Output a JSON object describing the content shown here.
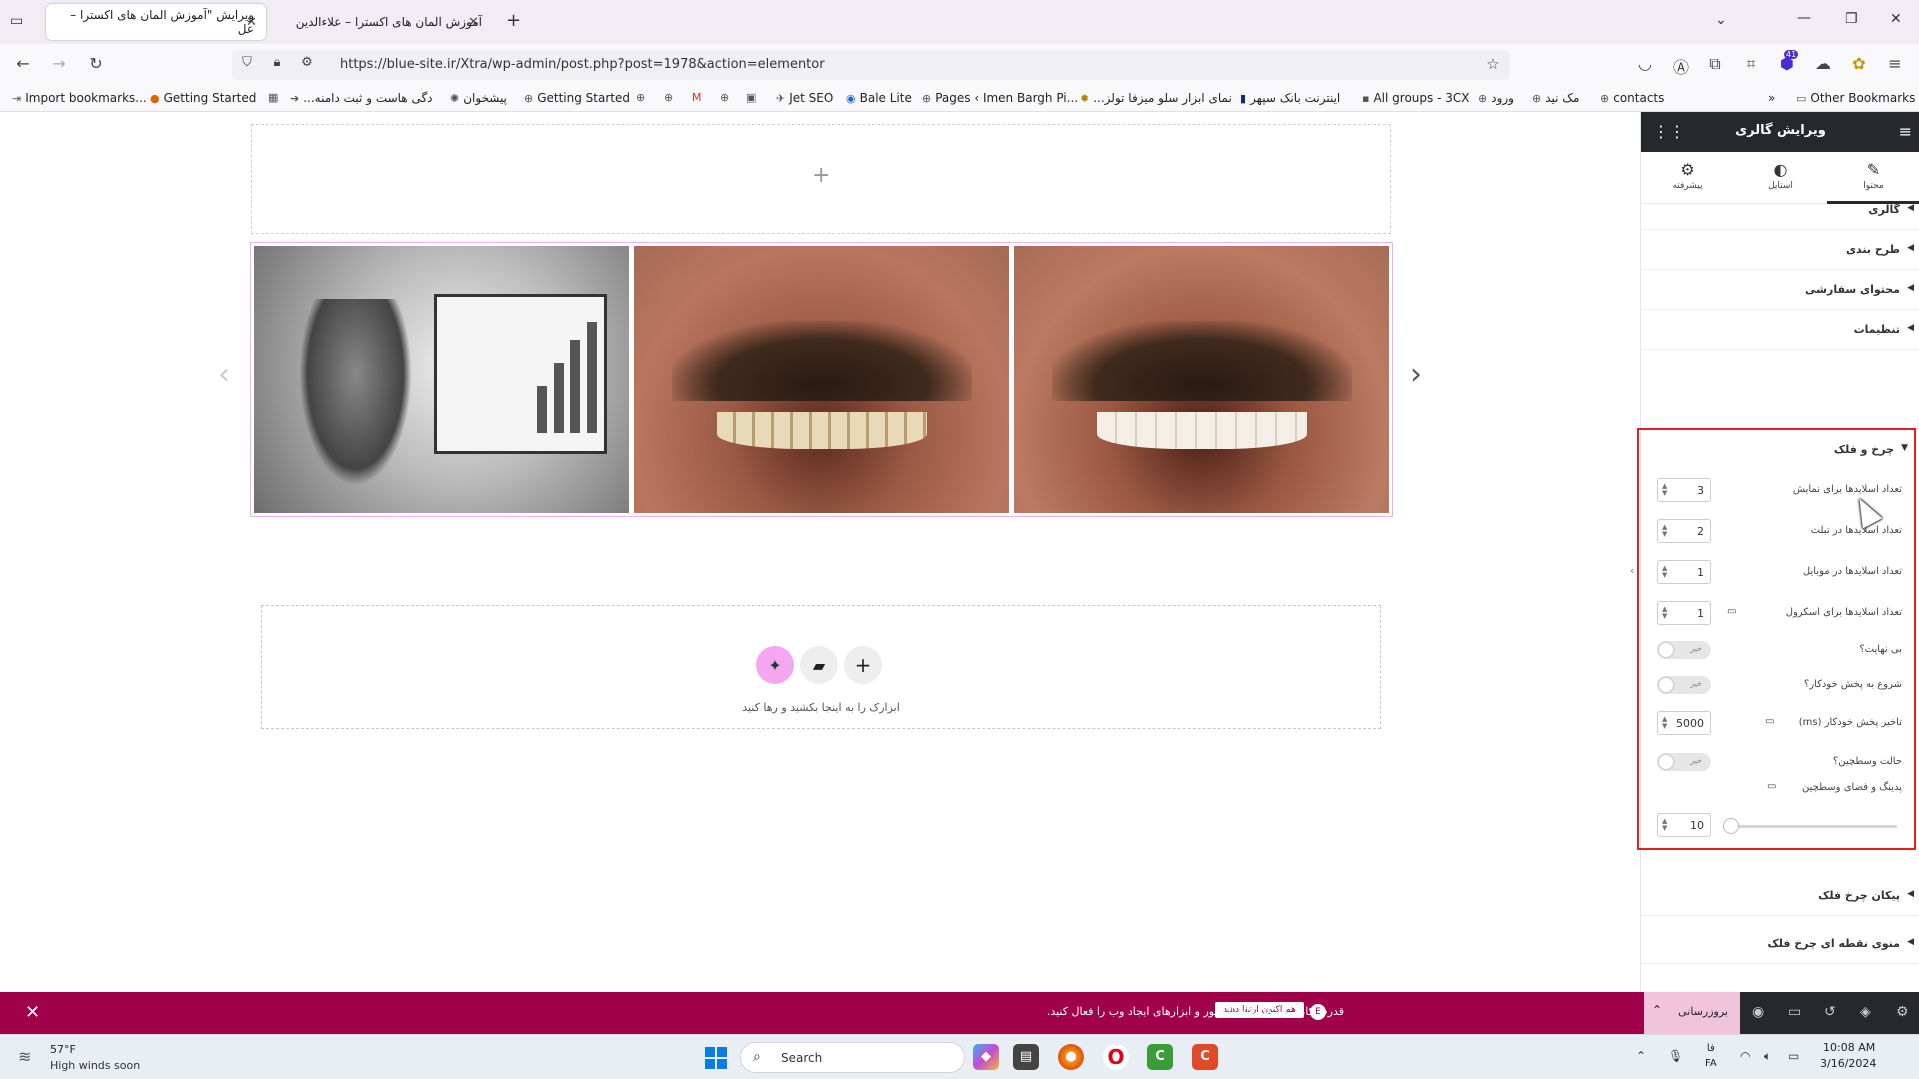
{
  "browser": {
    "tabs": [
      {
        "title": "ویرایش \"آموزش المان های اکسترا – عل",
        "active": true
      },
      {
        "title": "آموزش المان های اکسترا – علاءالدین",
        "active": false
      }
    ],
    "new_tab": "+",
    "close_glyph": "✕",
    "url": "https://blue-site.ir/Xtra/wp-admin/post.php?post=1978&action=elementor",
    "extension_badge": "41",
    "bookmarks": [
      {
        "label": "Import bookmarks...",
        "icon": "import-icon"
      },
      {
        "label": "Getting Started",
        "icon": "firefox-icon"
      },
      {
        "label": "...دگی هاست و ثبت دامنه",
        "icon": "arrow-icon"
      },
      {
        "label": "پیشخوان",
        "icon": "wp-icon"
      },
      {
        "label": "Getting Started",
        "icon": "globe-icon"
      },
      {
        "label": "Jet SEO",
        "icon": "jet-icon"
      },
      {
        "label": "Bale Lite",
        "icon": "bale-icon"
      },
      {
        "label": "Pages ‹ Imen Bargh Pi...",
        "icon": "globe-icon"
      },
      {
        "label": "...نمای ابزار سلو میزفا تولز",
        "icon": "tools-icon"
      },
      {
        "label": "اینترنت بانک سپهر",
        "icon": "bank-icon"
      },
      {
        "label": "All groups - 3CX",
        "icon": "3cx-icon"
      },
      {
        "label": "ورود",
        "icon": "globe-icon"
      },
      {
        "label": "مک نید",
        "icon": "globe-icon"
      },
      {
        "label": "contacts",
        "icon": "globe-icon"
      }
    ],
    "other_bookmarks": "Other Bookmarks"
  },
  "canvas": {
    "add_glyph": "+",
    "drop_text": "ابزارک را به اینجا بکشید و رها کنید",
    "slides": [
      "genie-image",
      "smile-before-image",
      "smile-after-image"
    ],
    "arrow_prev": "‹",
    "arrow_next": "›"
  },
  "panel": {
    "title": "ویرایش گالری",
    "tabs": [
      {
        "label": "محتوا",
        "icon": "pencil-icon",
        "active": true
      },
      {
        "label": "استایل",
        "icon": "contrast-icon",
        "active": false
      },
      {
        "label": "پیشرفته",
        "icon": "gear-icon",
        "active": false
      }
    ],
    "sections_top": [
      "گالری",
      "طرح بندی",
      "محتوای سفارشی",
      "تنظیمات"
    ],
    "carousel": {
      "title": "چرخ و فلک",
      "slides_to_show": {
        "label": "تعداد اسلایدها برای نمایش",
        "value": "3"
      },
      "slides_tablet": {
        "label": "تعداد اسلایدها در تبلت",
        "value": "2"
      },
      "slides_mobile": {
        "label": "تعداد اسلایدها در موبایل",
        "value": "1"
      },
      "slides_scroll": {
        "label": "تعداد اسلایدها برای اسکرول",
        "value": "1"
      },
      "infinite": {
        "label": "بی نهایت؟",
        "state": "خیر"
      },
      "autoplay": {
        "label": "شروع به پخش خودکار؟",
        "state": "خیر"
      },
      "autoplay_delay": {
        "label": "تاخیر پخش خودکار (ms)",
        "value": "5000"
      },
      "center_mode": {
        "label": "حالت وسطچین؟",
        "state": "خیر"
      },
      "center_padding": {
        "label": "پدینگ و فضای وسطچین",
        "value": "10"
      }
    },
    "sections_bottom": [
      "پیکان چرخ فلک",
      "منوی نقطه ای چرخ فلک"
    ]
  },
  "footer": {
    "promo_text": "قدرت کامل ویژگی های المنتور و ابزارهای ایجاد وب را فعال کنید.",
    "promo_button": "هم اکنون ارتقا دهید",
    "update_button": "بروزرسانی",
    "close_glyph": "✕"
  },
  "taskbar": {
    "weather_temp": "57°F",
    "weather_desc": "High winds soon",
    "search_label": "Search",
    "lang_top": "فا",
    "lang_bottom": "FA",
    "time": "10:08 AM",
    "date": "3/16/2024"
  },
  "colors": {
    "panel_header": "#26292c",
    "promo_bar": "#a1004a",
    "highlight_border": "#e02020",
    "update_button": "#f0c5dc",
    "start_blue": "#0a7ce3"
  }
}
